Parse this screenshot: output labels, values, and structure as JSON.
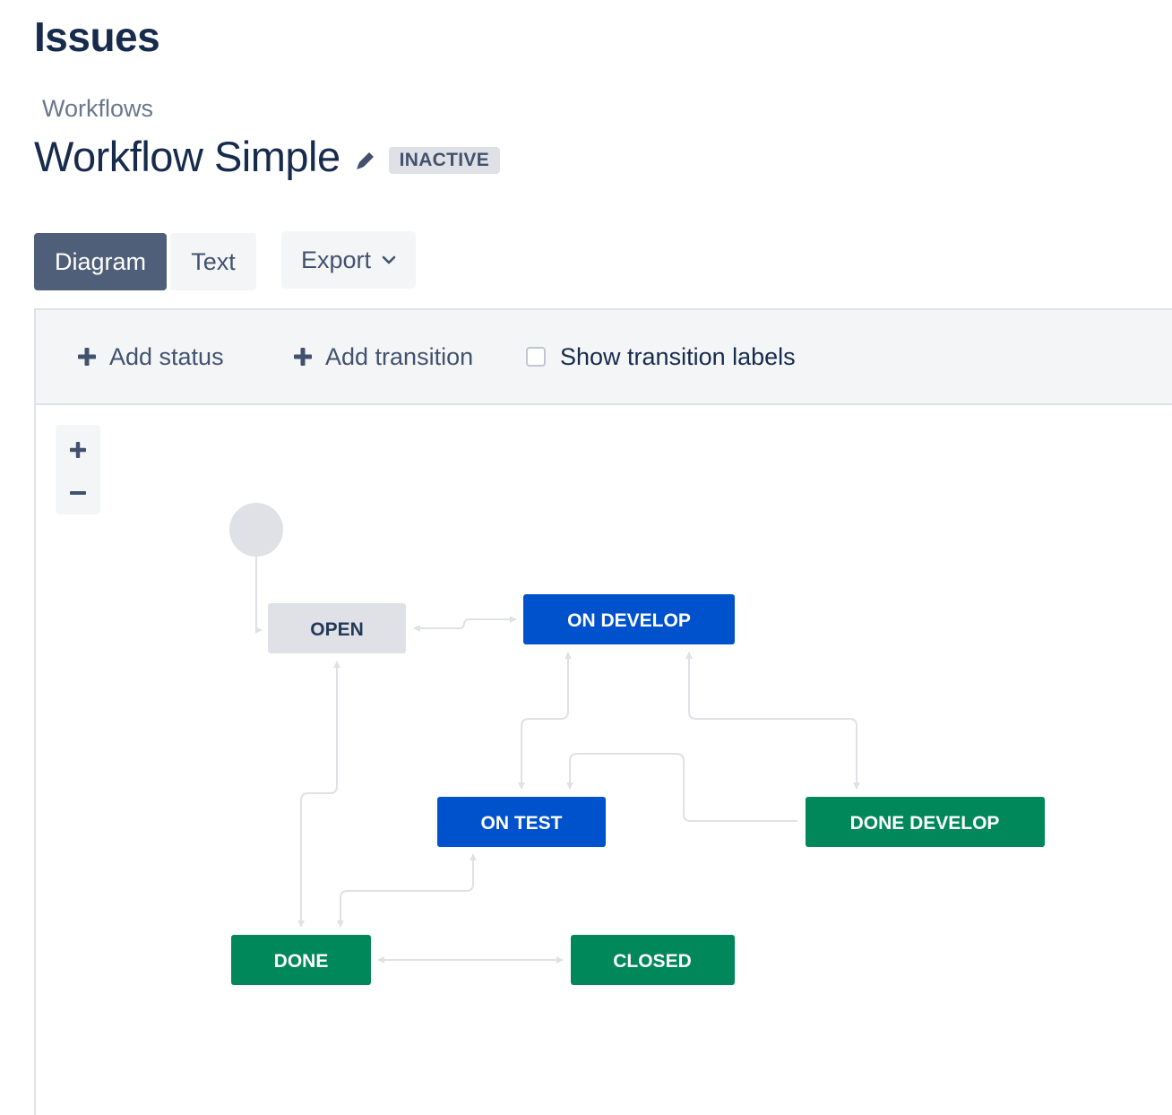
{
  "page": {
    "heading": "Issues"
  },
  "breadcrumb": {
    "label": "Workflows"
  },
  "workflow": {
    "name": "Workflow Simple",
    "status": "INACTIVE"
  },
  "view_tabs": {
    "diagram": "Diagram",
    "text": "Text",
    "active": "Diagram"
  },
  "export": {
    "label": "Export"
  },
  "toolbar": {
    "add_status": "Add status",
    "add_transition": "Add transition",
    "show_labels": "Show transition labels",
    "show_labels_checked": false
  },
  "zoom": {
    "in_icon": "plus-icon",
    "out_icon": "minus-icon"
  },
  "colors": {
    "todo_bg": "#dfe1e6",
    "todo_text": "#253858",
    "inprogress_bg": "#0052cc",
    "done_bg": "#00875a",
    "status_text_light": "#ffffff",
    "edge": "#dfe1e6",
    "start_node": "#dfe1e6"
  },
  "statuses": {
    "open": "OPEN",
    "on_develop": "ON DEVELOP",
    "on_test": "ON TEST",
    "done_develop": "DONE DEVELOP",
    "done": "DONE",
    "closed": "CLOSED"
  }
}
